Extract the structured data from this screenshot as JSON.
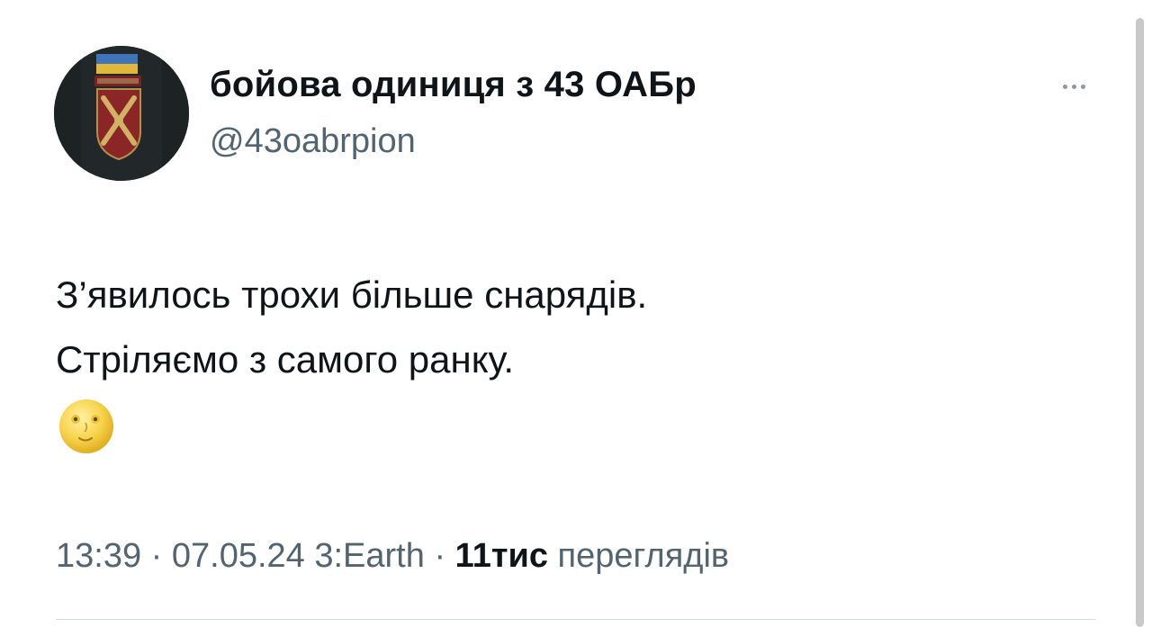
{
  "author": {
    "display_name": "бойова одиниця з 43 ОАБр",
    "handle": "@43oabrpion"
  },
  "tweet": {
    "lines": [
      "З’явилось трохи більше снарядів.",
      "Стріляємо з самого ранку."
    ],
    "emoji": "🌝"
  },
  "meta": {
    "time": "13:39",
    "separator": " · ",
    "date": "07.05.24",
    "source": "3:Earth",
    "views_count": "11тис",
    "views_label": "переглядів"
  },
  "icons": {
    "more": "more-horizontal-icon",
    "emoji": "full-moon-face-icon"
  },
  "colors": {
    "text_primary": "#0f1419",
    "text_secondary": "#536471",
    "divider": "#cfd9de"
  }
}
